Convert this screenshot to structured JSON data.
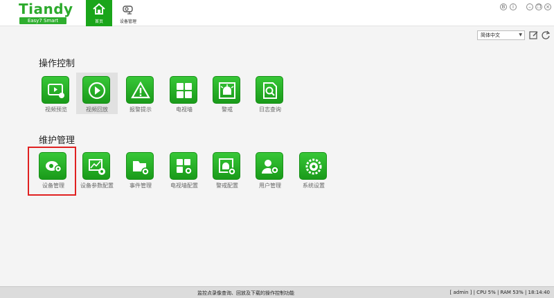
{
  "header": {
    "logo_text": "Tiandy",
    "logo_sub": "Easy7 Smart",
    "tabs": [
      {
        "label": "首页",
        "icon": "home-icon",
        "active": true
      },
      {
        "label": "设备管理",
        "icon": "camera-icon",
        "active": false
      }
    ],
    "window_controls": [
      {
        "icon": "help-icon",
        "glyph": "B"
      },
      {
        "icon": "info-icon",
        "glyph": "i"
      },
      {
        "icon": "minimize-icon",
        "glyph": "–"
      },
      {
        "icon": "restore-icon",
        "glyph": "❐"
      },
      {
        "icon": "close-icon",
        "glyph": "×"
      }
    ]
  },
  "language": {
    "selected": "简体中文"
  },
  "sections": [
    {
      "title": "操作控制",
      "items": [
        {
          "label": "视频预览",
          "icon": "video-preview-icon"
        },
        {
          "label": "视频回放",
          "icon": "video-playback-icon"
        },
        {
          "label": "报警提示",
          "icon": "alarm-warning-icon"
        },
        {
          "label": "电视墙",
          "icon": "tv-wall-icon"
        },
        {
          "label": "警戒",
          "icon": "guard-icon"
        },
        {
          "label": "日志查询",
          "icon": "log-search-icon"
        }
      ]
    },
    {
      "title": "维护管理",
      "items": [
        {
          "label": "设备管理",
          "icon": "device-management-icon"
        },
        {
          "label": "设备参数配置",
          "icon": "device-param-config-icon"
        },
        {
          "label": "事件管理",
          "icon": "event-management-icon"
        },
        {
          "label": "电视墙配置",
          "icon": "tv-wall-config-icon"
        },
        {
          "label": "警戒配置",
          "icon": "guard-config-icon"
        },
        {
          "label": "用户管理",
          "icon": "user-management-icon"
        },
        {
          "label": "系统设置",
          "icon": "system-settings-icon"
        }
      ]
    }
  ],
  "status": {
    "message": "监控点录像查询、回放及下载的操作控制功能",
    "right": "[ admin ] | CPU   5% | RAM   53% | 18:14:40"
  },
  "colors": {
    "accent": "#1aa51a",
    "highlight_outline": "#e02020"
  }
}
